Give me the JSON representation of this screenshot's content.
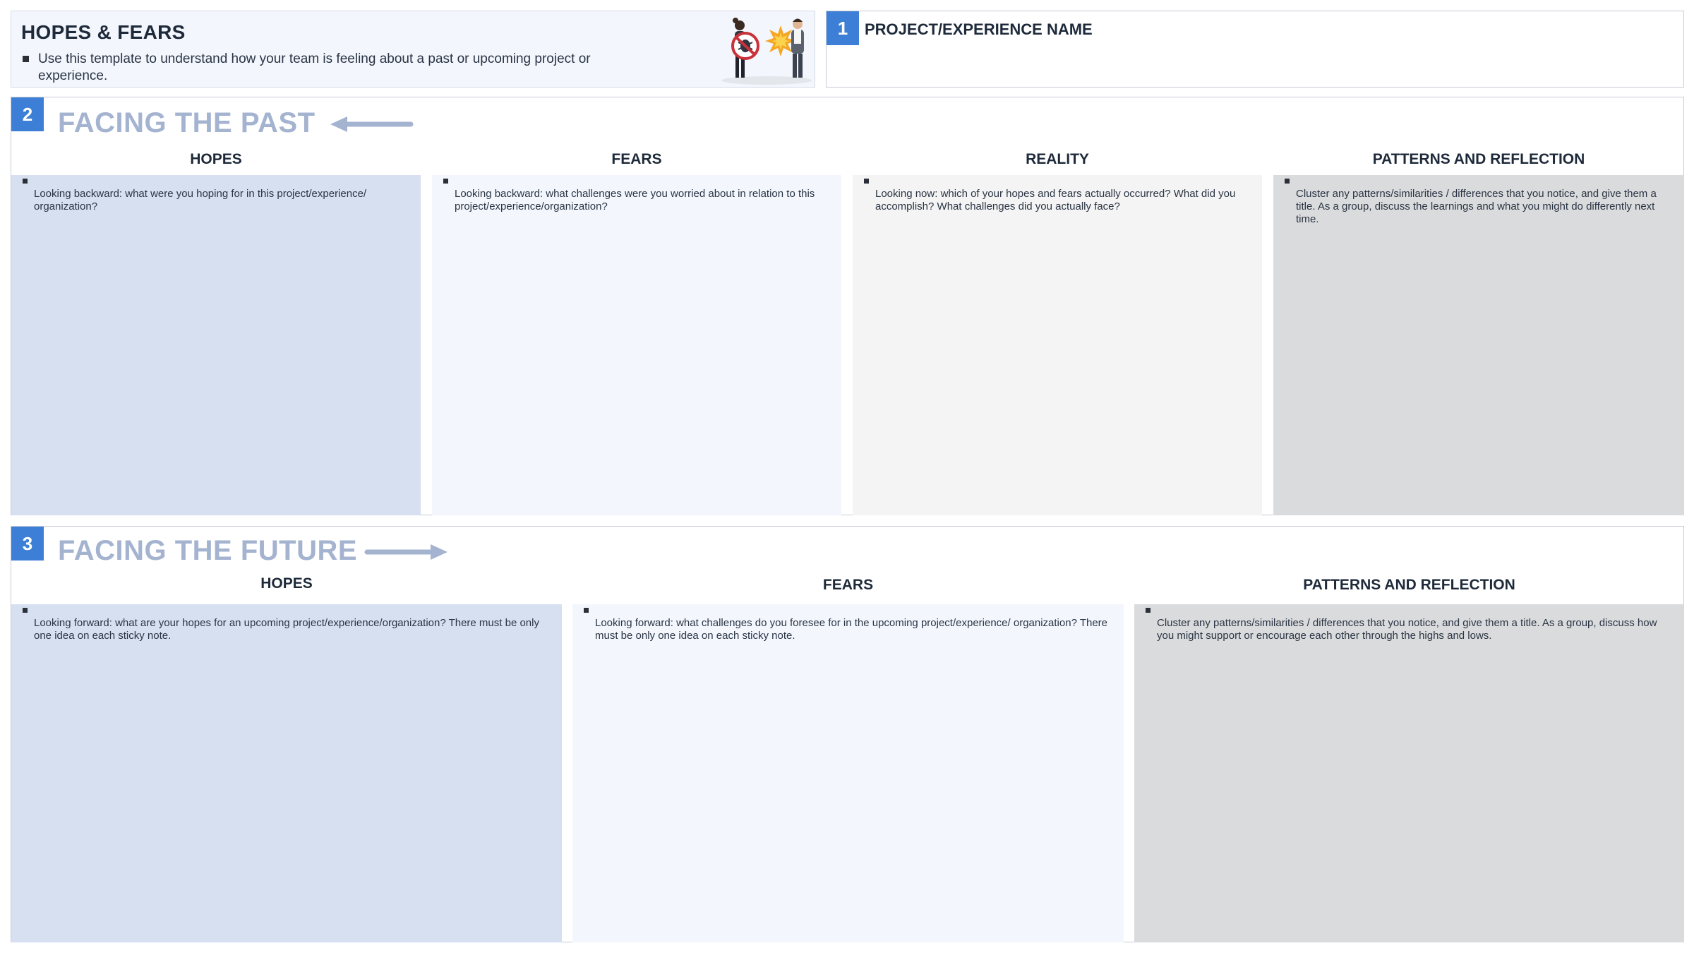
{
  "header": {
    "title": "HOPES & FEARS",
    "description": "Use this template to understand how your team is feeling about a past or upcoming project or experience."
  },
  "project": {
    "number": "1",
    "label": "PROJECT/EXPERIENCE NAME"
  },
  "past": {
    "number": "2",
    "title": "FACING THE PAST",
    "arrow_direction": "left",
    "columns": [
      {
        "heading": "HOPES",
        "prompt": "Looking backward: what were you hoping for in this project/experience/ organization?"
      },
      {
        "heading": "FEARS",
        "prompt": "Looking backward: what challenges were you worried about in relation to this project/experience/organization?"
      },
      {
        "heading": "REALITY",
        "prompt": "Looking now: which of your hopes and fears actually occurred? What did you accomplish? What challenges did you actually face?"
      },
      {
        "heading": "PATTERNS AND REFLECTION",
        "prompt": "Cluster any patterns/similarities / differences that you notice, and give them a title. As a group, discuss the learnings and what you might do differently next time."
      }
    ]
  },
  "future": {
    "number": "3",
    "title": "FACING THE FUTURE",
    "arrow_direction": "right",
    "columns": [
      {
        "heading": "HOPES",
        "prompt": "Looking forward: what are your hopes for an upcoming project/experience/organization? There must be only one idea on each sticky note."
      },
      {
        "heading": "FEARS",
        "prompt": "Looking forward: what challenges do you foresee for in the upcoming project/experience/ organization? There must be only one idea on each sticky note."
      },
      {
        "heading": "PATTERNS AND REFLECTION",
        "prompt": "Cluster any patterns/similarities / differences that you notice, and give them a title. As a group, discuss how you might support or encourage each other through the highs and lows."
      }
    ]
  },
  "colors": {
    "accent": "#3d7fd6",
    "section_title": "#a4b3cf",
    "panel_blue": "#d7e0f0",
    "panel_light": "#f3f7fd",
    "panel_gray": "#f4f4f4",
    "panel_dark": "#dadbdc"
  }
}
